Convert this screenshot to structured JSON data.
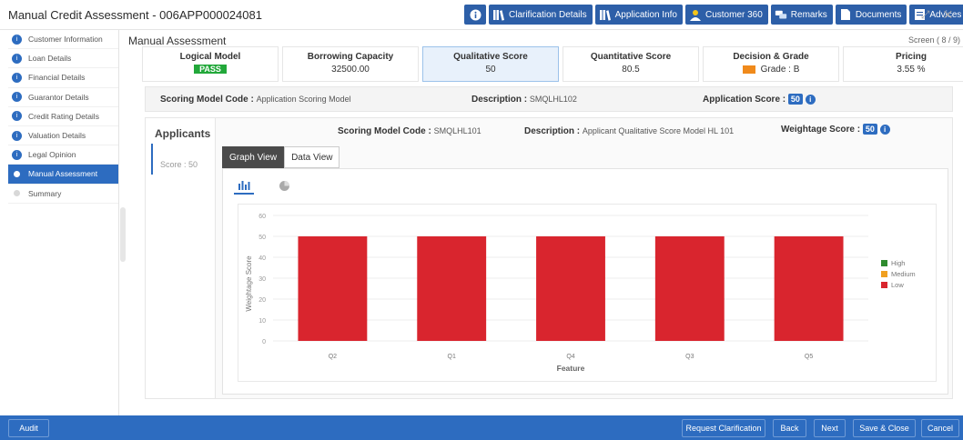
{
  "window": {
    "title": "Manual Credit Assessment - 006APP000024081"
  },
  "topbar": {
    "buttons": [
      {
        "label": "",
        "icon": "info-icon"
      },
      {
        "label": "Clarification Details",
        "icon": "books-icon"
      },
      {
        "label": "Application Info",
        "icon": "books-icon"
      },
      {
        "label": "Customer 360",
        "icon": "person-icon"
      },
      {
        "label": "Remarks",
        "icon": "chat-icon"
      },
      {
        "label": "Documents",
        "icon": "document-icon"
      },
      {
        "label": "Advices",
        "icon": "advice-icon"
      }
    ],
    "window_controls": "⤢ ✕"
  },
  "sidebar": {
    "items": [
      {
        "label": "Customer Information",
        "state": "complete"
      },
      {
        "label": "Loan Details",
        "state": "complete"
      },
      {
        "label": "Financial Details",
        "state": "complete"
      },
      {
        "label": "Guarantor Details",
        "state": "complete"
      },
      {
        "label": "Credit Rating Details",
        "state": "complete"
      },
      {
        "label": "Valuation Details",
        "state": "complete"
      },
      {
        "label": "Legal Opinion",
        "state": "complete"
      },
      {
        "label": "Manual Assessment",
        "state": "active"
      },
      {
        "label": "Summary",
        "state": "pending"
      }
    ]
  },
  "main": {
    "title": "Manual Assessment",
    "screen": "Screen ( 8 / 9)",
    "cards": [
      {
        "label": "Logical Model",
        "value": "PASS"
      },
      {
        "label": "Borrowing Capacity",
        "value": "32500.00"
      },
      {
        "label": "Qualitative Score",
        "value": "50"
      },
      {
        "label": "Quantitative Score",
        "value": "80.5"
      },
      {
        "label": "Decision & Grade",
        "value": "Grade : B"
      },
      {
        "label": "Pricing",
        "value": "3.55 %"
      }
    ],
    "info": {
      "model_label": "Scoring Model Code : ",
      "model_value": "Application Scoring Model",
      "desc_label": "Description : ",
      "desc_value": "SMQLHL102",
      "score_label": "Application Score : ",
      "score_value": "50"
    },
    "applicants": {
      "heading": "Applicants",
      "score_tab": "Score : 50",
      "model_label": "Scoring Model Code : ",
      "model_value": "SMQLHL101",
      "desc_label": "Description : ",
      "desc_value": "Applicant Qualitative Score Model HL 101",
      "weight_label": "Weightage Score : ",
      "weight_value": "50",
      "tabs": [
        "Graph View",
        "Data View"
      ]
    }
  },
  "chart_data": {
    "type": "bar",
    "categories": [
      "Q2",
      "Q1",
      "Q4",
      "Q3",
      "Q5"
    ],
    "series": [
      {
        "name": "Low",
        "values": [
          50,
          50,
          50,
          50,
          50
        ],
        "color": "#d9252e"
      }
    ],
    "legend": [
      {
        "name": "High",
        "color": "#2e8b2e"
      },
      {
        "name": "Medium",
        "color": "#f0a020"
      },
      {
        "name": "Low",
        "color": "#d9252e"
      }
    ],
    "xlabel": "Feature",
    "ylabel": "Weightage Score",
    "ylim": [
      0,
      60
    ],
    "yticks": [
      0,
      10,
      20,
      30,
      40,
      50,
      60
    ],
    "legend_position": "right"
  },
  "bottombar": {
    "audit": "Audit",
    "buttons": [
      "Request Clarification",
      "Back",
      "Next",
      "Save & Close",
      "Cancel"
    ]
  },
  "colors": {
    "primary": "#2d6cc0",
    "bar": "#d9252e",
    "pass": "#22a83a",
    "grade": "#f08a1b"
  }
}
